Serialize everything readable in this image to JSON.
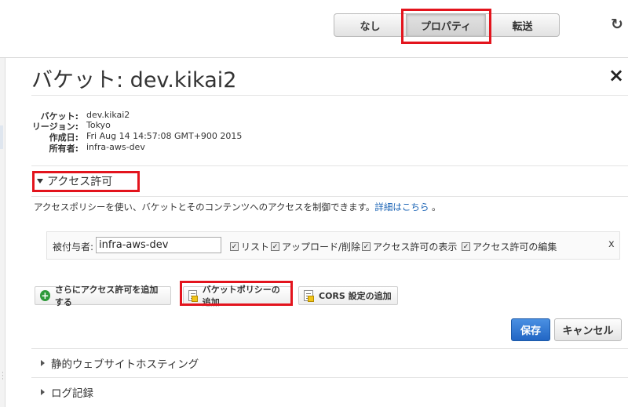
{
  "toolbar": {
    "seg_none": "なし",
    "seg_properties": "プロパティ",
    "seg_transfer": "転送",
    "refresh_icon": "↻"
  },
  "panel": {
    "title": "バケット: dev.kikai2",
    "close": "×"
  },
  "info": [
    {
      "label": "バケット:",
      "value": "dev.kikai2"
    },
    {
      "label": "リージョン:",
      "value": "Tokyo"
    },
    {
      "label": "作成日:",
      "value": "Fri Aug 14 14:57:08 GMT+900 2015"
    },
    {
      "label": "所有者:",
      "value": "infra-aws-dev"
    }
  ],
  "access": {
    "header": "アクセス許可",
    "description": "アクセスポリシーを使い、バケットとそのコンテンツへのアクセスを制御できます。",
    "details_link": "詳細はこちら",
    "description_end": " 。",
    "grantee_label": "被付与者:",
    "grantee_value": "infra-aws-dev",
    "checkboxes": [
      "リスト",
      "アップロード/削除",
      "アクセス許可の表示",
      "アクセス許可の編集"
    ],
    "remove": "x",
    "add_grant": "さらにアクセス許可を追加する",
    "add_policy": "バケットポリシーの追加",
    "add_cors": "CORS 設定の追加",
    "save": "保存",
    "cancel": "キャンセル"
  },
  "sections": {
    "web_hosting": "静的ウェブサイトホスティング",
    "logging": "ログ記録"
  },
  "colors": {
    "highlight": "#e3141d",
    "primary": "#2266c4",
    "link": "#1a63b5"
  }
}
